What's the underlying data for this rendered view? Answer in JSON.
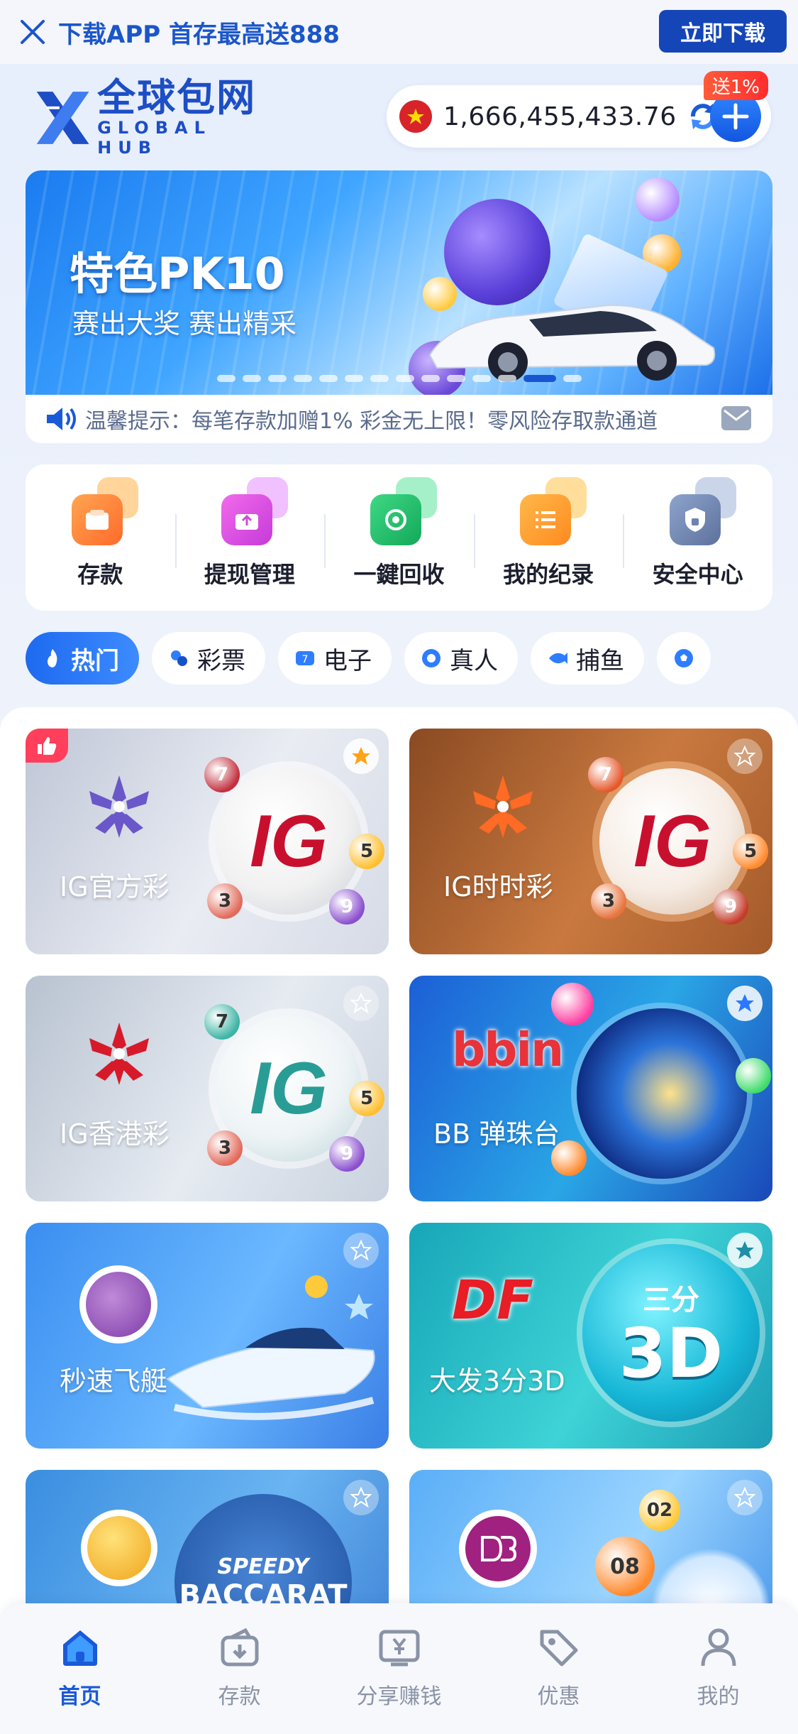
{
  "download_bar": {
    "text": "下载APP 首存最高送888",
    "button": "立即下载"
  },
  "header": {
    "logo_cn": "全球包网",
    "logo_en": "GLOBAL HUB",
    "balance": "1,666,455,433.76",
    "bonus_tag": "送1%"
  },
  "banner": {
    "title": "特色PK10",
    "subtitle": "赛出大奖 赛出精采",
    "slides_total": 14,
    "active_slide": 13
  },
  "marquee": {
    "text": "温馨提示：每笔存款加赠1% 彩金无上限！零风险存取款通道"
  },
  "actions": [
    {
      "label": "存款",
      "icon": "wallet-icon",
      "color": "#ff8a3d"
    },
    {
      "label": "提现管理",
      "icon": "withdraw-icon",
      "color": "#e04fd0"
    },
    {
      "label": "一鍵回收",
      "icon": "recycle-icon",
      "color": "#1fbf6a"
    },
    {
      "label": "我的纪录",
      "icon": "records-icon",
      "color": "#ff9a2e"
    },
    {
      "label": "安全中心",
      "icon": "shield-icon",
      "color": "#6d84b0"
    }
  ],
  "categories": [
    {
      "label": "热门",
      "active": true
    },
    {
      "label": "彩票",
      "active": false
    },
    {
      "label": "电子",
      "active": false
    },
    {
      "label": "真人",
      "active": false
    },
    {
      "label": "捕鱼",
      "active": false
    }
  ],
  "games": [
    {
      "name": "IG官方彩",
      "favorite": true
    },
    {
      "name": "IG时时彩",
      "favorite": false
    },
    {
      "name": "IG香港彩",
      "favorite": false
    },
    {
      "name": "BB 弹珠台",
      "favorite": true
    },
    {
      "name": "秒速飞艇",
      "favorite": false
    },
    {
      "name": "大发3分3D",
      "favorite": true
    },
    {
      "name": "",
      "favorite": false
    },
    {
      "name": "",
      "favorite": false
    }
  ],
  "game_art": {
    "ig_logo": "IG",
    "bbin_logo": "bbin",
    "df_logo": "DF",
    "sanfen_3d_top": "三分",
    "sanfen_3d": "3D",
    "speedy": "SPEEDY",
    "baccarat": "BACCARAT",
    "ball_numbers": [
      "7",
      "5",
      "3",
      "9"
    ],
    "lottery_numbers": [
      "02",
      "08"
    ]
  },
  "bottom_nav": [
    {
      "label": "首页",
      "icon": "home-icon",
      "active": true
    },
    {
      "label": "存款",
      "icon": "deposit-icon",
      "active": false
    },
    {
      "label": "分享赚钱",
      "icon": "share-earn-icon",
      "active": false
    },
    {
      "label": "优惠",
      "icon": "promo-tag-icon",
      "active": false
    },
    {
      "label": "我的",
      "icon": "profile-icon",
      "active": false
    }
  ]
}
